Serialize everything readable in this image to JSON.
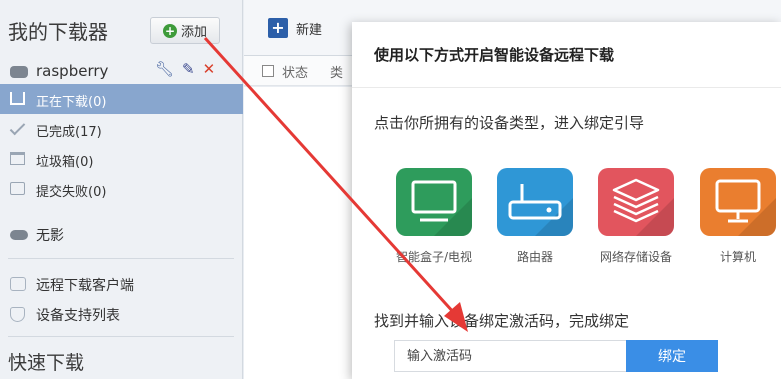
{
  "sidebar": {
    "title": "我的下载器",
    "add_label": "添加",
    "device_name": "raspberry",
    "items": [
      {
        "label": "正在下载(0)",
        "active": true
      },
      {
        "label": "已完成(17)"
      },
      {
        "label": "垃圾箱(0)"
      },
      {
        "label": "提交失败(0)"
      }
    ],
    "other_device": "无影",
    "links": [
      {
        "label": "远程下载客户端"
      },
      {
        "label": "设备支持列表"
      }
    ],
    "quick_download": "快速下载"
  },
  "toolbar": {
    "new_label": "新建"
  },
  "list_header": {
    "status": "状态",
    "type": "类"
  },
  "dialog": {
    "title": "使用以下方式开启智能设备远程下载",
    "instruction": "点击你所拥有的设备类型，进入绑定引导",
    "devices": [
      {
        "label": "智能盒子/电视",
        "color": "#2e9c5c",
        "icon": "tv-icon"
      },
      {
        "label": "路由器",
        "color": "#2f97d6",
        "icon": "router-icon"
      },
      {
        "label": "网络存储设备",
        "color": "#e2555e",
        "icon": "storage-layers-icon"
      },
      {
        "label": "计算机",
        "color": "#ea7e2f",
        "icon": "computer-monitor-icon"
      }
    ],
    "find_text": "找到并输入设备绑定激活码，完成绑定",
    "input_placeholder": "输入激活码",
    "bind_label": "绑定"
  },
  "colors": {
    "sidebar_active": "#88a6ce",
    "bind_button": "#3a8ee6",
    "arrow": "#e53935"
  }
}
